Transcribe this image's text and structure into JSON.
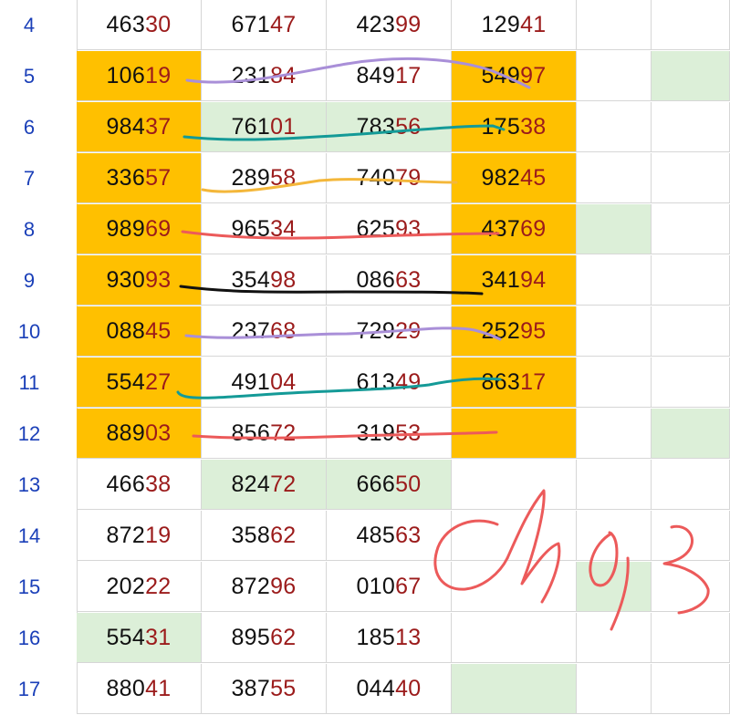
{
  "sheet": {
    "rows": [
      {
        "label": "4",
        "cells": [
          {
            "pre": "463",
            "suf": "30",
            "fill": "none"
          },
          {
            "pre": "671",
            "suf": "47",
            "fill": "none"
          },
          {
            "pre": "423",
            "suf": "99",
            "fill": "none"
          },
          {
            "pre": "129",
            "suf": "41",
            "fill": "none"
          },
          {
            "pre": "",
            "suf": "",
            "fill": "none"
          },
          {
            "pre": "",
            "suf": "",
            "fill": "none"
          }
        ]
      },
      {
        "label": "5",
        "cells": [
          {
            "pre": "106",
            "suf": "19",
            "fill": "orange"
          },
          {
            "pre": "231",
            "suf": "84",
            "fill": "none"
          },
          {
            "pre": "849",
            "suf": "17",
            "fill": "none"
          },
          {
            "pre": "549",
            "suf": "97",
            "fill": "orange"
          },
          {
            "pre": "",
            "suf": "",
            "fill": "none"
          },
          {
            "pre": "",
            "suf": "",
            "fill": "green"
          }
        ]
      },
      {
        "label": "6",
        "cells": [
          {
            "pre": "984",
            "suf": "37",
            "fill": "orange"
          },
          {
            "pre": "761",
            "suf": "01",
            "fill": "green"
          },
          {
            "pre": "783",
            "suf": "56",
            "fill": "green"
          },
          {
            "pre": "175",
            "suf": "38",
            "fill": "orange"
          },
          {
            "pre": "",
            "suf": "",
            "fill": "none"
          },
          {
            "pre": "",
            "suf": "",
            "fill": "none"
          }
        ]
      },
      {
        "label": "7",
        "cells": [
          {
            "pre": "336",
            "suf": "57",
            "fill": "orange"
          },
          {
            "pre": "289",
            "suf": "58",
            "fill": "none"
          },
          {
            "pre": "740",
            "suf": "79",
            "fill": "none"
          },
          {
            "pre": "982",
            "suf": "45",
            "fill": "orange"
          },
          {
            "pre": "",
            "suf": "",
            "fill": "none"
          },
          {
            "pre": "",
            "suf": "",
            "fill": "none"
          }
        ]
      },
      {
        "label": "8",
        "cells": [
          {
            "pre": "989",
            "suf": "69",
            "fill": "orange"
          },
          {
            "pre": "965",
            "suf": "34",
            "fill": "none"
          },
          {
            "pre": "625",
            "suf": "93",
            "fill": "none"
          },
          {
            "pre": "437",
            "suf": "69",
            "fill": "orange"
          },
          {
            "pre": "",
            "suf": "",
            "fill": "green"
          },
          {
            "pre": "",
            "suf": "",
            "fill": "none"
          }
        ]
      },
      {
        "label": "9",
        "cells": [
          {
            "pre": "930",
            "suf": "93",
            "fill": "orange"
          },
          {
            "pre": "354",
            "suf": "98",
            "fill": "none"
          },
          {
            "pre": "086",
            "suf": "63",
            "fill": "none"
          },
          {
            "pre": "341",
            "suf": "94",
            "fill": "orange"
          },
          {
            "pre": "",
            "suf": "",
            "fill": "none"
          },
          {
            "pre": "",
            "suf": "",
            "fill": "none"
          }
        ]
      },
      {
        "label": "10",
        "cells": [
          {
            "pre": "088",
            "suf": "45",
            "fill": "orange"
          },
          {
            "pre": "237",
            "suf": "68",
            "fill": "none"
          },
          {
            "pre": "729",
            "suf": "29",
            "fill": "none"
          },
          {
            "pre": "252",
            "suf": "95",
            "fill": "orange"
          },
          {
            "pre": "",
            "suf": "",
            "fill": "none"
          },
          {
            "pre": "",
            "suf": "",
            "fill": "none"
          }
        ]
      },
      {
        "label": "11",
        "cells": [
          {
            "pre": "554",
            "suf": "27",
            "fill": "orange"
          },
          {
            "pre": "491",
            "suf": "04",
            "fill": "none"
          },
          {
            "pre": "613",
            "suf": "49",
            "fill": "none"
          },
          {
            "pre": "863",
            "suf": "17",
            "fill": "orange"
          },
          {
            "pre": "",
            "suf": "",
            "fill": "none"
          },
          {
            "pre": "",
            "suf": "",
            "fill": "none"
          }
        ]
      },
      {
        "label": "12",
        "cells": [
          {
            "pre": "889",
            "suf": "03",
            "fill": "orange"
          },
          {
            "pre": "856",
            "suf": "72",
            "fill": "none"
          },
          {
            "pre": "319",
            "suf": "53",
            "fill": "none"
          },
          {
            "pre": "",
            "suf": "",
            "fill": "orange"
          },
          {
            "pre": "",
            "suf": "",
            "fill": "none"
          },
          {
            "pre": "",
            "suf": "",
            "fill": "green"
          }
        ]
      },
      {
        "label": "13",
        "cells": [
          {
            "pre": "466",
            "suf": "38",
            "fill": "none"
          },
          {
            "pre": "824",
            "suf": "72",
            "fill": "green"
          },
          {
            "pre": "666",
            "suf": "50",
            "fill": "green"
          },
          {
            "pre": "",
            "suf": "",
            "fill": "none"
          },
          {
            "pre": "",
            "suf": "",
            "fill": "none"
          },
          {
            "pre": "",
            "suf": "",
            "fill": "none"
          }
        ]
      },
      {
        "label": "14",
        "cells": [
          {
            "pre": "872",
            "suf": "19",
            "fill": "none"
          },
          {
            "pre": "358",
            "suf": "62",
            "fill": "none"
          },
          {
            "pre": "485",
            "suf": "63",
            "fill": "none"
          },
          {
            "pre": "",
            "suf": "",
            "fill": "none"
          },
          {
            "pre": "",
            "suf": "",
            "fill": "none"
          },
          {
            "pre": "",
            "suf": "",
            "fill": "none"
          }
        ]
      },
      {
        "label": "15",
        "cells": [
          {
            "pre": "202",
            "suf": "22",
            "fill": "none"
          },
          {
            "pre": "872",
            "suf": "96",
            "fill": "none"
          },
          {
            "pre": "010",
            "suf": "67",
            "fill": "none"
          },
          {
            "pre": "",
            "suf": "",
            "fill": "none"
          },
          {
            "pre": "",
            "suf": "",
            "fill": "green"
          },
          {
            "pre": "",
            "suf": "",
            "fill": "none"
          }
        ]
      },
      {
        "label": "16",
        "cells": [
          {
            "pre": "554",
            "suf": "31",
            "fill": "green"
          },
          {
            "pre": "895",
            "suf": "62",
            "fill": "none"
          },
          {
            "pre": "185",
            "suf": "13",
            "fill": "none"
          },
          {
            "pre": "",
            "suf": "",
            "fill": "none"
          },
          {
            "pre": "",
            "suf": "",
            "fill": "none"
          },
          {
            "pre": "",
            "suf": "",
            "fill": "none"
          }
        ]
      },
      {
        "label": "17",
        "cells": [
          {
            "pre": "880",
            "suf": "41",
            "fill": "none"
          },
          {
            "pre": "387",
            "suf": "55",
            "fill": "none"
          },
          {
            "pre": "044",
            "suf": "40",
            "fill": "none"
          },
          {
            "pre": "",
            "suf": "",
            "fill": "green"
          },
          {
            "pre": "",
            "suf": "",
            "fill": "none"
          },
          {
            "pre": "",
            "suf": "",
            "fill": "none"
          }
        ]
      }
    ]
  },
  "colors": {
    "fill_orange": "#ffc000",
    "fill_green": "#dcefd8",
    "row_number": "#1a3fb8",
    "digit_prefix": "#111111",
    "digit_suffix": "#9b1b1b",
    "ink_purple": "#a98fd8",
    "ink_teal": "#149a97",
    "ink_yellow": "#f4b73a",
    "ink_red": "#ec5a5a",
    "ink_black": "#111111"
  },
  "annotations": {
    "signature_ink": "red-handwritten-signature",
    "stroke_colors": [
      "purple",
      "teal",
      "yellow",
      "red",
      "black",
      "purple",
      "teal",
      "red"
    ]
  }
}
